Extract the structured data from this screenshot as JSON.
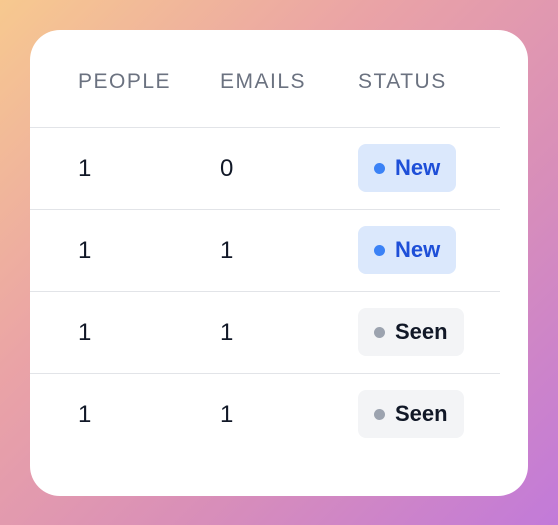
{
  "table": {
    "headers": [
      "PEOPLE",
      "EMAILS",
      "STATUS"
    ],
    "rows": [
      {
        "people": "1",
        "emails": "0",
        "status": "New"
      },
      {
        "people": "1",
        "emails": "1",
        "status": "New"
      },
      {
        "people": "1",
        "emails": "1",
        "status": "Seen"
      },
      {
        "people": "1",
        "emails": "1",
        "status": "Seen"
      }
    ]
  },
  "colors": {
    "new_bg": "#dbe8fc",
    "new_text": "#1e4fd8",
    "new_dot": "#3b82f6",
    "seen_bg": "#f3f4f6",
    "seen_text": "#111827",
    "seen_dot": "#9ca3af"
  },
  "icons": {
    "status_dot": "dot-icon"
  }
}
